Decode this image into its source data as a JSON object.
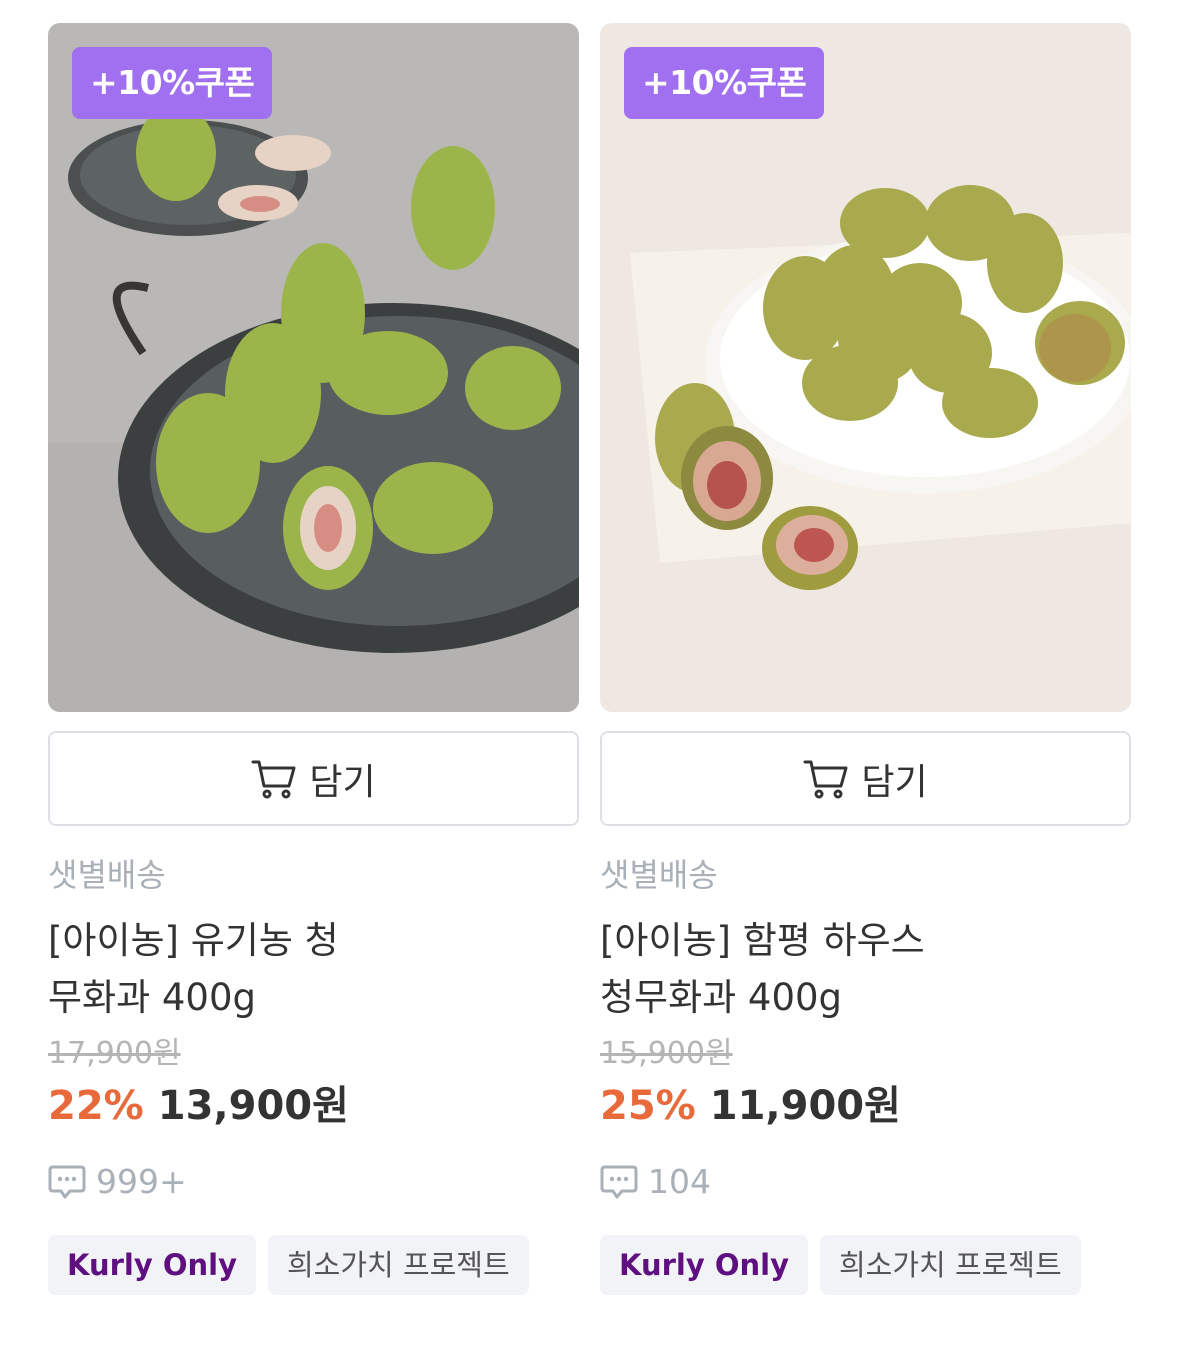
{
  "products": [
    {
      "coupon": "+10%쿠폰",
      "cart_label": "담기",
      "delivery": "샛별배송",
      "name": "[아이농] 유기농 청 무화과 400g",
      "original_price": "17,900원",
      "discount": "22%",
      "price": "13,900원",
      "reviews": "999+",
      "tags": [
        "Kurly Only",
        "희소가치 프로젝트"
      ]
    },
    {
      "coupon": "+10%쿠폰",
      "cart_label": "담기",
      "delivery": "샛별배송",
      "name": "[아이농] 함평 하우스 청무화과 400g",
      "original_price": "15,900원",
      "discount": "25%",
      "price": "11,900원",
      "reviews": "104",
      "tags": [
        "Kurly Only",
        "희소가치 프로젝트"
      ]
    }
  ],
  "colors": {
    "coupon_bg": "#a070f0",
    "discount": "#e8693a",
    "kurly_tag": "#5f0f80"
  }
}
